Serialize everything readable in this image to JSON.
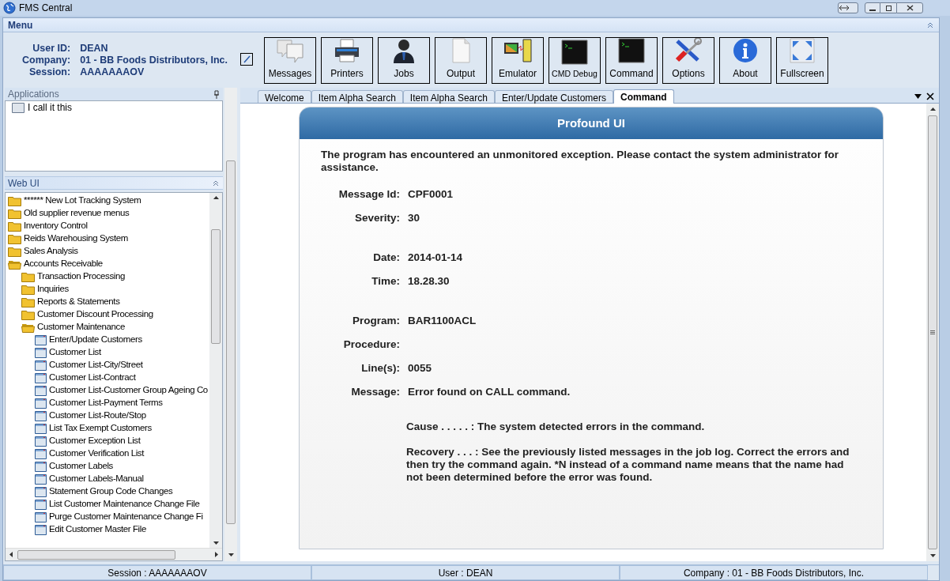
{
  "window": {
    "title": "FMS Central"
  },
  "menu": {
    "title": "Menu",
    "fields": [
      {
        "label": "User ID:",
        "value": "DEAN"
      },
      {
        "label": "Company:",
        "value": "01 - BB Foods Distributors, Inc."
      },
      {
        "label": "Session:",
        "value": "AAAAAAAOV"
      }
    ]
  },
  "toolbar": [
    {
      "kind": "messages",
      "label": "Messages"
    },
    {
      "kind": "printers",
      "label": "Printers"
    },
    {
      "kind": "jobs",
      "label": "Jobs"
    },
    {
      "kind": "output",
      "label": "Output"
    },
    {
      "kind": "emulator",
      "label": "Emulator"
    },
    {
      "kind": "terminal",
      "label": "CMD Debug"
    },
    {
      "kind": "terminal",
      "label": "Command"
    },
    {
      "kind": "options",
      "label": "Options"
    },
    {
      "kind": "about",
      "label": "About"
    },
    {
      "kind": "fullscreen",
      "label": "Fullscreen"
    }
  ],
  "applications": {
    "title": "Applications",
    "items": [
      "I call it this"
    ]
  },
  "web_ui": {
    "title": "Web UI",
    "tree": [
      {
        "kind": "folder",
        "label": "****** New Lot Tracking System",
        "expanded": false
      },
      {
        "kind": "folder",
        "label": "Old supplier revenue menus",
        "expanded": false
      },
      {
        "kind": "folder",
        "label": "Inventory Control",
        "expanded": false
      },
      {
        "kind": "folder",
        "label": "Reids Warehousing System",
        "expanded": false
      },
      {
        "kind": "folder",
        "label": "Sales Analysis",
        "expanded": false
      },
      {
        "kind": "folder",
        "label": "Accounts Receivable",
        "expanded": true,
        "children": [
          {
            "kind": "folder",
            "label": "Transaction Processing",
            "expanded": false
          },
          {
            "kind": "folder",
            "label": "Inquiries",
            "expanded": false
          },
          {
            "kind": "folder",
            "label": "Reports & Statements",
            "expanded": false
          },
          {
            "kind": "folder",
            "label": "Customer Discount Processing",
            "expanded": false
          },
          {
            "kind": "folder",
            "label": "Customer Maintenance",
            "expanded": true,
            "children": [
              {
                "kind": "program",
                "label": "Enter/Update Customers"
              },
              {
                "kind": "program",
                "label": "Customer List"
              },
              {
                "kind": "program",
                "label": "Customer List-City/Street"
              },
              {
                "kind": "program",
                "label": "Customer List-Contract"
              },
              {
                "kind": "program",
                "label": "Customer List-Customer Group Ageing Co"
              },
              {
                "kind": "program",
                "label": "Customer List-Payment Terms"
              },
              {
                "kind": "program",
                "label": "Customer List-Route/Stop"
              },
              {
                "kind": "program",
                "label": "List Tax Exempt Customers"
              },
              {
                "kind": "program",
                "label": "Customer Exception List"
              },
              {
                "kind": "program",
                "label": "Customer Verification List"
              },
              {
                "kind": "program",
                "label": "Customer Labels"
              },
              {
                "kind": "program",
                "label": "Customer Labels-Manual"
              },
              {
                "kind": "program",
                "label": "Statement Group Code Changes"
              },
              {
                "kind": "program",
                "label": "List Customer Maintenance Change File"
              },
              {
                "kind": "program",
                "label": "Purge Customer Maintenance Change Fi"
              },
              {
                "kind": "program",
                "label": "Edit Customer Master File"
              }
            ]
          }
        ]
      }
    ]
  },
  "tabs": [
    {
      "label": "Welcome",
      "selected": false
    },
    {
      "label": "Item Alpha Search",
      "selected": false
    },
    {
      "label": "Item Alpha Search",
      "selected": false
    },
    {
      "label": "Enter/Update Customers",
      "selected": false
    },
    {
      "label": "Command",
      "selected": true
    }
  ],
  "panel": {
    "title": "Profound UI",
    "intro": "The program has encountered an unmonitored exception. Please contact the system administrator for assistance.",
    "field_groups": [
      [
        {
          "label": "Message Id:",
          "value": "CPF0001"
        },
        {
          "label": "Severity:",
          "value": "30"
        }
      ],
      [
        {
          "label": "Date:",
          "value": "2014-01-14"
        },
        {
          "label": "Time:",
          "value": "18.28.30"
        }
      ],
      [
        {
          "label": "Program:",
          "value": "BAR1100ACL"
        },
        {
          "label": "Procedure:"
        },
        {
          "label": "Line(s):",
          "value": "0055"
        },
        {
          "label": "Message:",
          "value": "Error found on CALL command."
        }
      ]
    ],
    "details": [
      "Cause . . . . . : The system detected errors in the command.",
      "Recovery . . . : See the previously listed messages in the job log. Correct the errors and then try the command again. *N instead of a command name means that the name had not been determined before the error was found."
    ]
  },
  "status_bar": [
    "Session : AAAAAAAOV",
    "User : DEAN",
    "Company : 01 - BB Foods Distributors, Inc."
  ]
}
